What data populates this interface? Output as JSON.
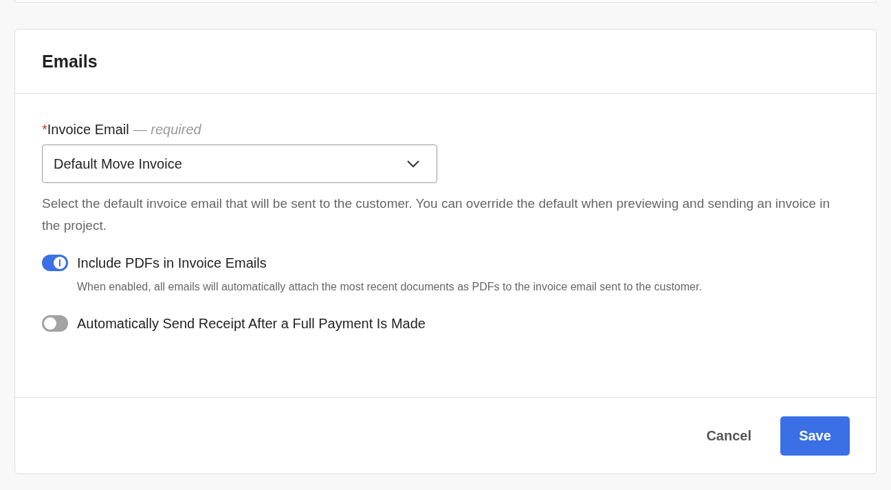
{
  "card": {
    "title": "Emails"
  },
  "field": {
    "required_mark": "*",
    "label": "Invoice Email",
    "hint": "— required",
    "value": "Default Move Invoice",
    "help": "Select the default invoice email that will be sent to the customer. You can override the default when previewing and sending an invoice in the project."
  },
  "toggles": [
    {
      "label": "Include PDFs in Invoice Emails",
      "on": true,
      "description": "When enabled, all emails will automatically attach the most recent documents as PDFs to the invoice email sent to the customer."
    },
    {
      "label": "Automatically Send Receipt After a Full Payment Is Made",
      "on": false
    }
  ],
  "buttons": {
    "cancel": "Cancel",
    "save": "Save"
  }
}
